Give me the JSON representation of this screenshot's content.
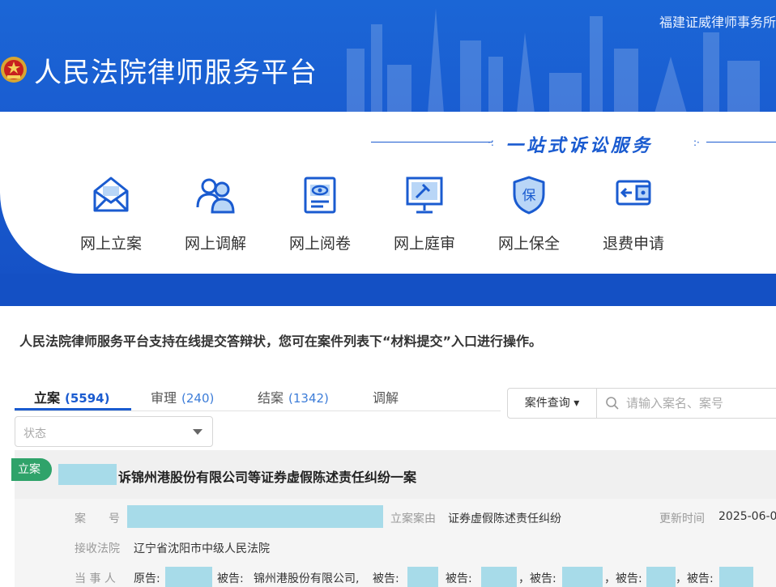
{
  "header": {
    "firm_name": "福建证威律师事务所",
    "platform_title": "人民法院律师服务平台",
    "slogan": "一站式诉讼服务",
    "brand_color": "#1a5bd0"
  },
  "services": [
    {
      "label": "网上立案",
      "icon": "envelope-icon"
    },
    {
      "label": "网上调解",
      "icon": "people-icon"
    },
    {
      "label": "网上阅卷",
      "icon": "document-eye-icon"
    },
    {
      "label": "网上庭审",
      "icon": "monitor-gavel-icon"
    },
    {
      "label": "网上保全",
      "icon": "shield-icon"
    },
    {
      "label": "退费申请",
      "icon": "refund-icon"
    }
  ],
  "notice": "人民法院律师服务平台支持在线提交答辩状，您可在案件列表下“材料提交”入口进行操作。",
  "tabs": [
    {
      "label": "立案",
      "count": "(5594)",
      "active": true
    },
    {
      "label": "审理",
      "count": "(240)",
      "active": false
    },
    {
      "label": "结案",
      "count": "(1342)",
      "active": false
    },
    {
      "label": "调解",
      "count": "",
      "active": false
    }
  ],
  "search": {
    "type_label": "案件查询 ▾",
    "placeholder": "请输入案名、案号"
  },
  "filter": {
    "status_placeholder": "状态"
  },
  "case": {
    "status_tag": "立案",
    "title": "诉锦州港股份有限公司等证券虚假陈述责任纠纷一案",
    "case_no_label": "案　　号",
    "cause_label": "立案案由",
    "cause_value": "证券虚假陈述责任纠纷",
    "updated_label": "更新时间",
    "updated_value": "2025-06-0",
    "court_label": "接收法院",
    "court_value": "辽宁省沈阳市中级人民法院",
    "parties_label": "当 事 人",
    "plaintiff_prefix": "原告:",
    "defendant_prefix": "被告:",
    "defendant_named": "锦州港股份有限公司,",
    "defendant_2": "被告:",
    "defendant_3": "被告:",
    "defendant_4": "，被告:",
    "defendant_5": "，被告:",
    "defendant_6": "，被告:"
  },
  "colors": {
    "tag_green": "#2fa36a",
    "redaction": "#a7dbe9"
  }
}
